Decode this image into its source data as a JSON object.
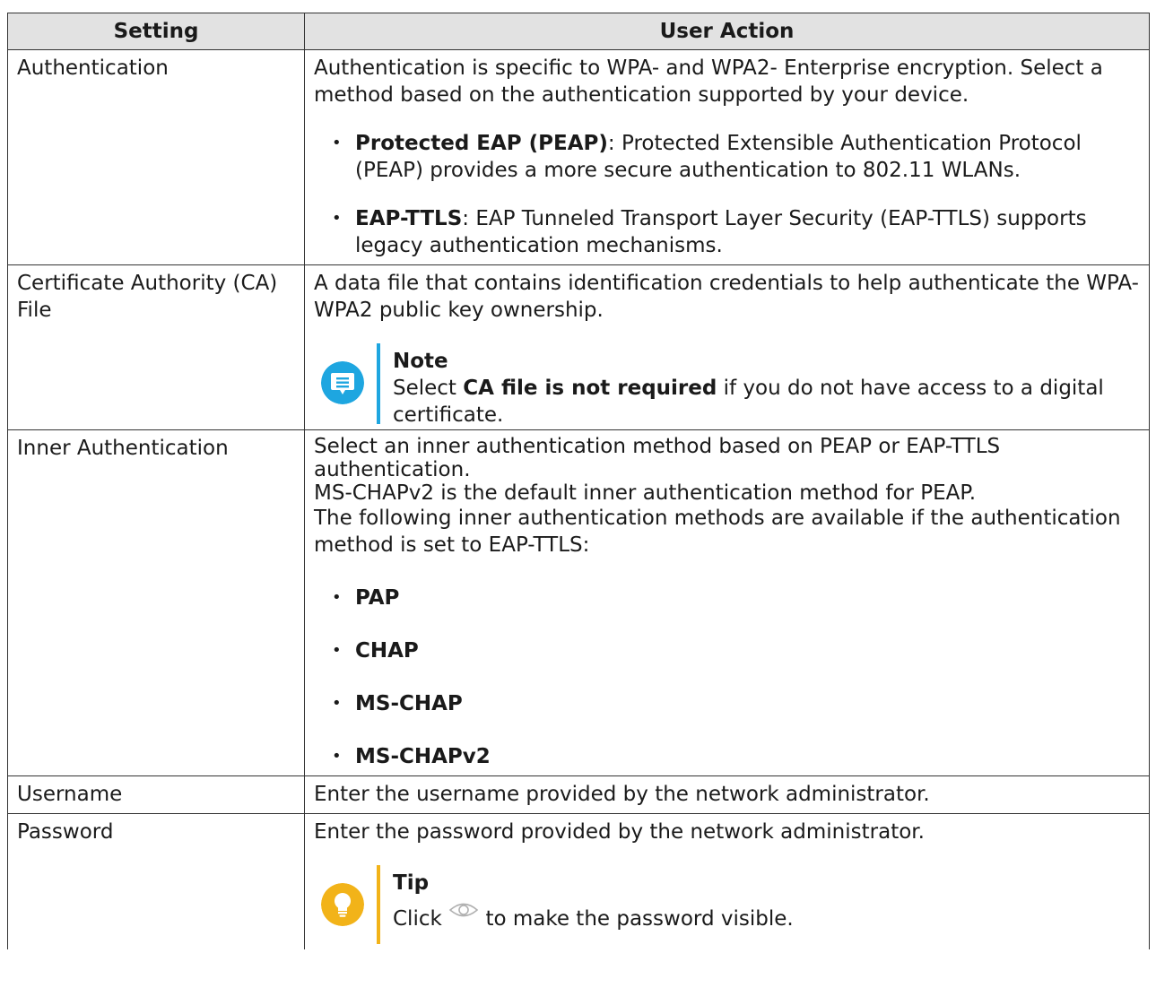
{
  "table": {
    "header": {
      "setting": "Setting",
      "user_action": "User Action"
    },
    "rows": {
      "authentication": {
        "setting": "Authentication",
        "description": "Authentication is specific to WPA- and WPA2- Enterprise encryption. Select a method based on the authentication supported by your device.",
        "items": [
          {
            "term": "Protected EAP (PEAP)",
            "text": ": Protected Extensible Authentication Protocol (PEAP) provides a more secure authentication to 802.11 WLANs."
          },
          {
            "term": "EAP-TTLS",
            "text": ": EAP Tunneled Transport Layer Security (EAP-TTLS) supports legacy authentication mechanisms."
          }
        ]
      },
      "ca_file": {
        "setting": "Certificate Authority (CA) File",
        "description": "A data file that contains identification credentials to help authenticate the WPA-WPA2 public key ownership.",
        "note": {
          "title": "Note",
          "text_before": "Select ",
          "bold": "CA file is not required",
          "text_after": " if you do not have access to a digital certificate."
        }
      },
      "inner_authentication": {
        "setting": "Inner Authentication",
        "line1": "Select an inner authentication method based on PEAP or EAP-TTLS authentication.",
        "line2": "MS-CHAPv2 is the default inner authentication method for PEAP.",
        "line3": "The following inner authentication methods are available if the authentication method is set to EAP-TTLS:",
        "items": [
          "PAP",
          "CHAP",
          "MS-CHAP",
          "MS-CHAPv2"
        ]
      },
      "username": {
        "setting": "Username",
        "description": "Enter the username provided by the network administrator."
      },
      "password": {
        "setting": "Password",
        "description": "Enter the password provided by the network administrator.",
        "tip": {
          "title": "Tip",
          "text_before": "Click ",
          "text_after": " to make the password visible."
        }
      }
    }
  },
  "colors": {
    "header_bg": "#e2e2e2",
    "note_accent": "#1ea6e0",
    "tip_accent": "#f2b319"
  },
  "icons": {
    "note": "note-icon",
    "tip": "lightbulb-icon",
    "visibility": "eye-icon"
  }
}
